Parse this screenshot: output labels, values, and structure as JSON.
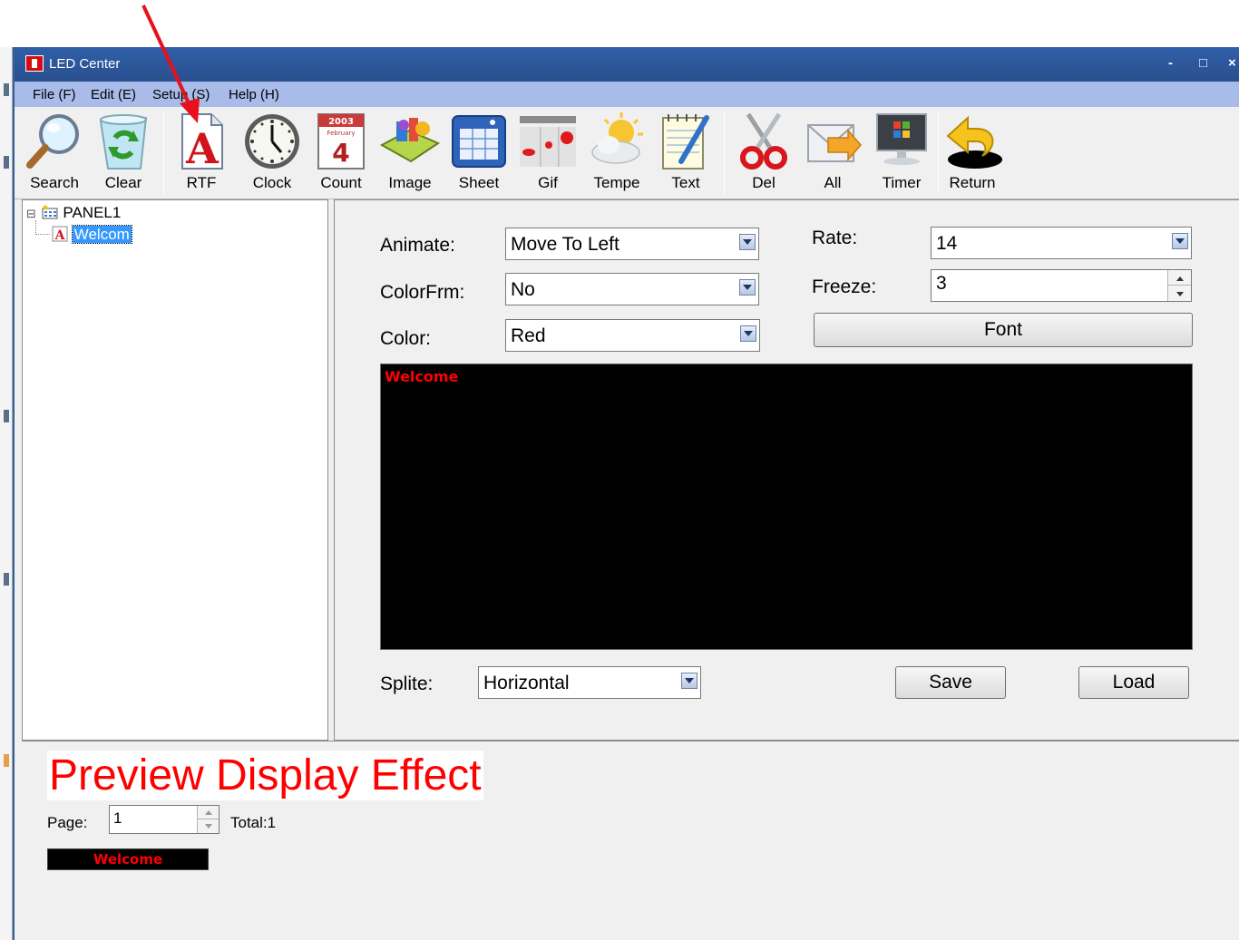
{
  "window": {
    "title": "LED Center",
    "controls": {
      "minimize": "-",
      "maximize": "□",
      "close": "×"
    }
  },
  "menu": [
    "File (F)",
    "Edit (E)",
    "Setup (S)",
    "Help (H)"
  ],
  "toolbar": {
    "buttons": [
      {
        "label": "Search",
        "icon": "magnifier-icon"
      },
      {
        "label": "Clear",
        "icon": "recycle-bin-icon"
      },
      {
        "label": "RTF",
        "icon": "rtf-letter-a-icon"
      },
      {
        "label": "Clock",
        "icon": "clock-icon"
      },
      {
        "label": "Count",
        "icon": "calendar-icon"
      },
      {
        "label": "Image",
        "icon": "image-icon"
      },
      {
        "label": "Sheet",
        "icon": "sheet-icon"
      },
      {
        "label": "Gif",
        "icon": "gif-icon"
      },
      {
        "label": "Tempe",
        "icon": "weather-icon"
      },
      {
        "label": "Text",
        "icon": "notepad-icon"
      },
      {
        "label": "Del",
        "icon": "scissors-icon"
      },
      {
        "label": "All",
        "icon": "envelope-icon"
      },
      {
        "label": "Timer",
        "icon": "monitor-icon"
      },
      {
        "label": "Return",
        "icon": "return-arrow-icon"
      }
    ],
    "calendar_icon_text": {
      "year": "2003",
      "month": "February",
      "day": "4"
    }
  },
  "tree": {
    "root": {
      "label": "PANEL1",
      "expander": "⊟"
    },
    "child": {
      "label": "Welcom",
      "selected": true
    }
  },
  "props": {
    "animate": {
      "label": "Animate:",
      "value": "Move To Left"
    },
    "colorfrm": {
      "label": "ColorFrm:",
      "value": "No"
    },
    "color": {
      "label": "Color:",
      "value": "Red"
    },
    "rate": {
      "label": "Rate:",
      "value": "14"
    },
    "freeze": {
      "label": "Freeze:",
      "value": "3"
    },
    "font_button": "Font",
    "canvas_text": "Welcome",
    "splite": {
      "label": "Splite:",
      "value": "Horizontal"
    },
    "save_button": "Save",
    "load_button": "Load"
  },
  "preview": {
    "title": "Preview Display Effect",
    "page_label": "Page:",
    "page_value": "1",
    "total": "Total:1",
    "led_text": "Welcome"
  },
  "colors": {
    "titlebar": "#2f5fa8",
    "menubar": "#a9bbe9",
    "led_text": "#ff0000",
    "selection": "#3399ff",
    "annotation_arrow": "#e8101b"
  }
}
